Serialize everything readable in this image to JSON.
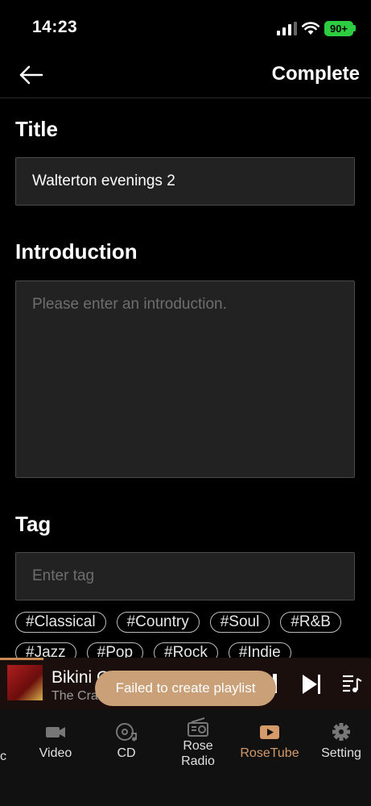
{
  "status_bar": {
    "time": "14:23",
    "battery": "90+"
  },
  "header": {
    "complete_label": "Complete"
  },
  "title_section": {
    "label": "Title",
    "value": "Walterton evenings 2"
  },
  "intro_section": {
    "label": "Introduction",
    "placeholder": "Please enter an introduction."
  },
  "tag_section": {
    "label": "Tag",
    "placeholder": "Enter tag",
    "tags_row1": [
      "#Classical",
      "#Country",
      "#Soul",
      "#R&B"
    ],
    "tags_row2": [
      "#Jazz",
      "#Pop",
      "#Rock",
      "#Indie"
    ]
  },
  "player": {
    "track_title": "Bikini C",
    "track_artist": "The Cra"
  },
  "toast": {
    "message": "Failed to create playlist"
  },
  "nav": {
    "stub": "c",
    "items": [
      {
        "label": "Video",
        "icon": "video-icon"
      },
      {
        "label": "CD",
        "icon": "cd-icon"
      },
      {
        "label": "Rose\nRadio",
        "icon": "radio-icon"
      },
      {
        "label": "RoseTube",
        "icon": "rosetube-icon",
        "active": true
      },
      {
        "label": "Setting",
        "icon": "gear-icon"
      }
    ]
  },
  "colors": {
    "accent": "#d49a6a",
    "toast": "#c9a078",
    "battery": "#2ecc40",
    "field_bg": "#222222"
  }
}
